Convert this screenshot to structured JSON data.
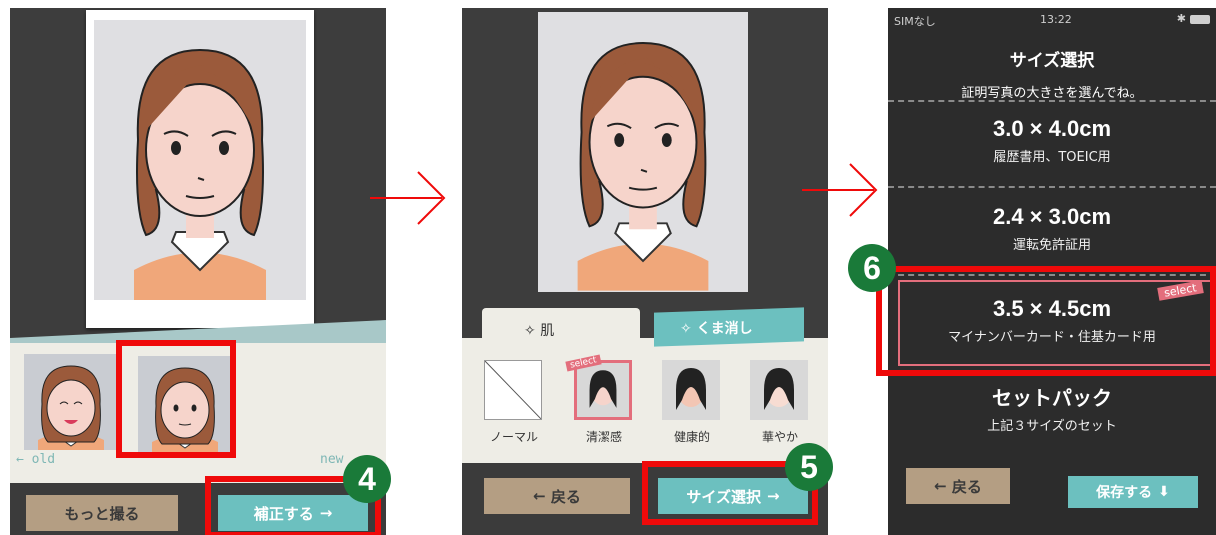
{
  "panel1": {
    "old_label": "old",
    "new_label": "new",
    "more_button": "もっと撮る",
    "correct_button": "補正する",
    "badge": "4"
  },
  "panel2": {
    "tab_skin": "肌",
    "tab_kuma": "くま消し",
    "select_tag": "select",
    "swatches": [
      {
        "label": "ノーマル"
      },
      {
        "label": "清潔感"
      },
      {
        "label": "健康的"
      },
      {
        "label": "華やか"
      }
    ],
    "back_button": "戻る",
    "size_button": "サイズ選択",
    "badge": "5"
  },
  "panel3": {
    "status_carrier": "SIMなし",
    "status_time": "13:22",
    "title": "サイズ選択",
    "subtitle": "証明写真の大きさを選んでね。",
    "options": [
      {
        "size": "3.0 × 4.0cm",
        "use": "履歴書用、TOEIC用"
      },
      {
        "size": "2.4 × 3.0cm",
        "use": "運転免許証用"
      },
      {
        "size": "3.5 × 4.5cm",
        "use": "マイナンバーカード・住基カード用"
      },
      {
        "size": "セットパック",
        "use": "上記３サイズのセット"
      }
    ],
    "select_tag": "select",
    "back_button": "戻る",
    "save_button": "保存する",
    "badge": "6"
  },
  "colors": {
    "accent_red": "#ef0a0a",
    "badge_green": "#1a7a39",
    "teal": "#6cc0bf",
    "tan": "#b49e83"
  }
}
